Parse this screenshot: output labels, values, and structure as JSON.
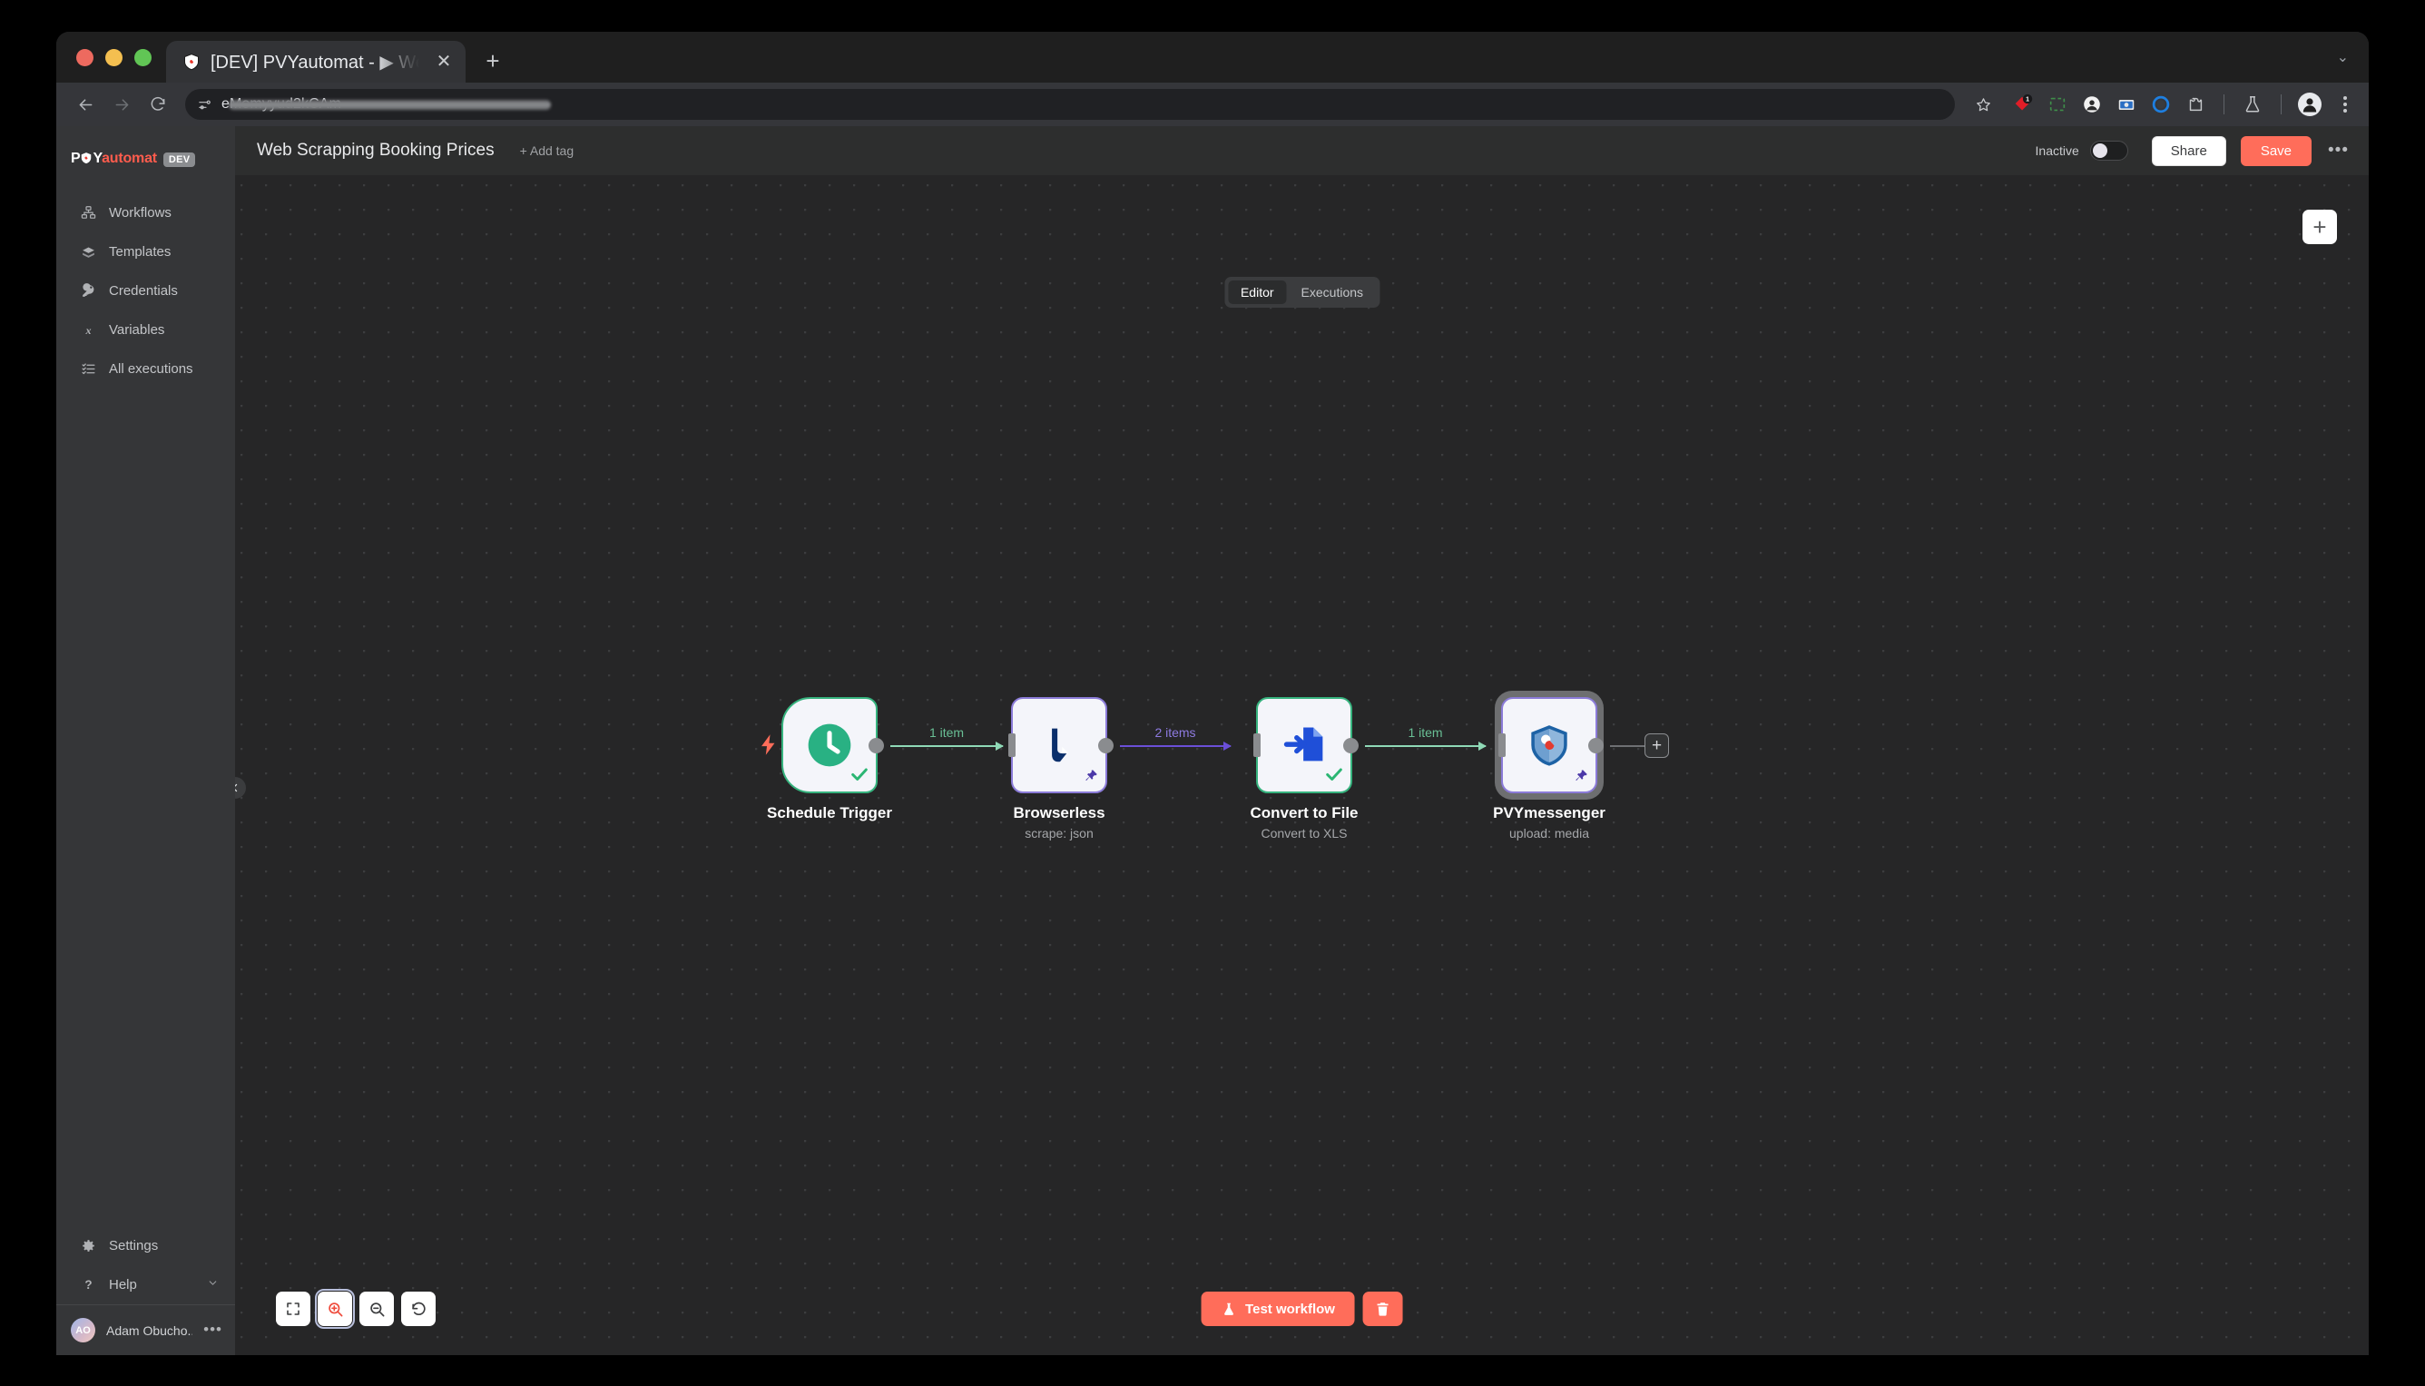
{
  "browser": {
    "tab": {
      "title": "[DEV] PVYautomat - ▶ Web S",
      "favicon_icon": "shield-favicon",
      "close_icon": "close-icon"
    },
    "new_tab_icon": "plus-icon",
    "window_chevron_icon": "chevron-down-icon",
    "nav": {
      "back_icon": "back-arrow-icon",
      "forward_icon": "forward-arrow-icon",
      "reload_icon": "reload-icon"
    },
    "omnibox": {
      "site_settings_icon": "tune-icon",
      "url_visible_text": "eMomyyud2kCAm",
      "url_redacted": true
    },
    "bookmark_icon": "star-icon",
    "extensions": [
      {
        "name": "extension-red-diamond-icon",
        "badge": "1"
      },
      {
        "name": "extension-green-dashed-square-icon",
        "badge": ""
      },
      {
        "name": "extension-face-circle-icon",
        "badge": ""
      },
      {
        "name": "extension-camera-icon",
        "badge": ""
      },
      {
        "name": "extension-blue-circle-icon",
        "badge": ""
      },
      {
        "name": "extensions-puzzle-icon",
        "badge": ""
      }
    ],
    "lab_icon": "flask-icon",
    "profile_icon": "profile-avatar-icon",
    "menu_icon": "kebab-menu-icon"
  },
  "sidebar": {
    "brand": {
      "text_prefix": "P",
      "shield_icon": "pvy-shield-logo-icon",
      "text_mid": "Y",
      "text_suffix": "automat",
      "badge": "DEV"
    },
    "items": [
      {
        "label": "Workflows",
        "icon": "workflows-icon"
      },
      {
        "label": "Templates",
        "icon": "templates-icon"
      },
      {
        "label": "Credentials",
        "icon": "key-icon"
      },
      {
        "label": "Variables",
        "icon": "variables-icon"
      },
      {
        "label": "All executions",
        "icon": "executions-list-icon"
      }
    ],
    "bottom_items": [
      {
        "label": "Settings",
        "icon": "gear-icon",
        "chevron": false
      },
      {
        "label": "Help",
        "icon": "question-mark-icon",
        "chevron": true
      }
    ],
    "user": {
      "initials": "AO",
      "name": "Adam Obucho...",
      "menu_icon": "kebab-menu-icon"
    }
  },
  "header": {
    "workflow_title": "Web Scrapping Booking Prices",
    "add_tag_label": "+ Add tag",
    "activation_label": "Inactive",
    "activation_state": "off",
    "share_label": "Share",
    "save_label": "Save",
    "more_icon": "ellipsis-icon",
    "tabs": [
      {
        "label": "Editor",
        "active": true
      },
      {
        "label": "Executions",
        "active": false
      }
    ]
  },
  "canvas": {
    "collapse_icon": "chevron-left-icon",
    "add_node_icon": "plus-icon",
    "end_add_icon": "plus-icon",
    "nodes": [
      {
        "label": "Schedule Trigger",
        "sublabel": "",
        "icon": "clock-icon",
        "type": "trigger",
        "border": "green",
        "status": "success",
        "pinned": false,
        "selected": false,
        "trigger_bolt_icon": "lightning-bolt-icon"
      },
      {
        "label": "Browserless",
        "sublabel": "scrape: json",
        "icon": "browserless-icon",
        "type": "node",
        "border": "purple",
        "status": "none",
        "pinned": true,
        "selected": false
      },
      {
        "label": "Convert to File",
        "sublabel": "Convert to XLS",
        "icon": "convert-to-file-icon",
        "type": "node",
        "border": "green",
        "status": "success",
        "pinned": false,
        "selected": false
      },
      {
        "label": "PVYmessenger",
        "sublabel": "upload: media",
        "icon": "pvy-shield-icon",
        "type": "node",
        "border": "purple",
        "status": "none",
        "pinned": true,
        "selected": true
      }
    ],
    "connections": [
      {
        "label": "1 item",
        "color": "green"
      },
      {
        "label": "2 items",
        "color": "purple"
      },
      {
        "label": "1 item",
        "color": "green"
      }
    ]
  },
  "zoom_toolbar": [
    {
      "name": "zoom-to-fit-button",
      "icon": "fit-screen-icon",
      "focused": false
    },
    {
      "name": "zoom-in-button",
      "icon": "zoom-in-icon",
      "focused": true
    },
    {
      "name": "zoom-out-button",
      "icon": "zoom-out-icon",
      "focused": false
    },
    {
      "name": "reset-zoom-button",
      "icon": "undo-icon",
      "focused": false
    }
  ],
  "run_toolbar": {
    "test_label": "Test workflow",
    "test_icon": "flask-icon",
    "delete_icon": "trash-icon"
  },
  "colors": {
    "accent": "#ff6d5a",
    "success": "#36b37e",
    "purple": "#6b4fd8",
    "canvas_bg": "#262627",
    "sidebar_bg": "#353638"
  }
}
